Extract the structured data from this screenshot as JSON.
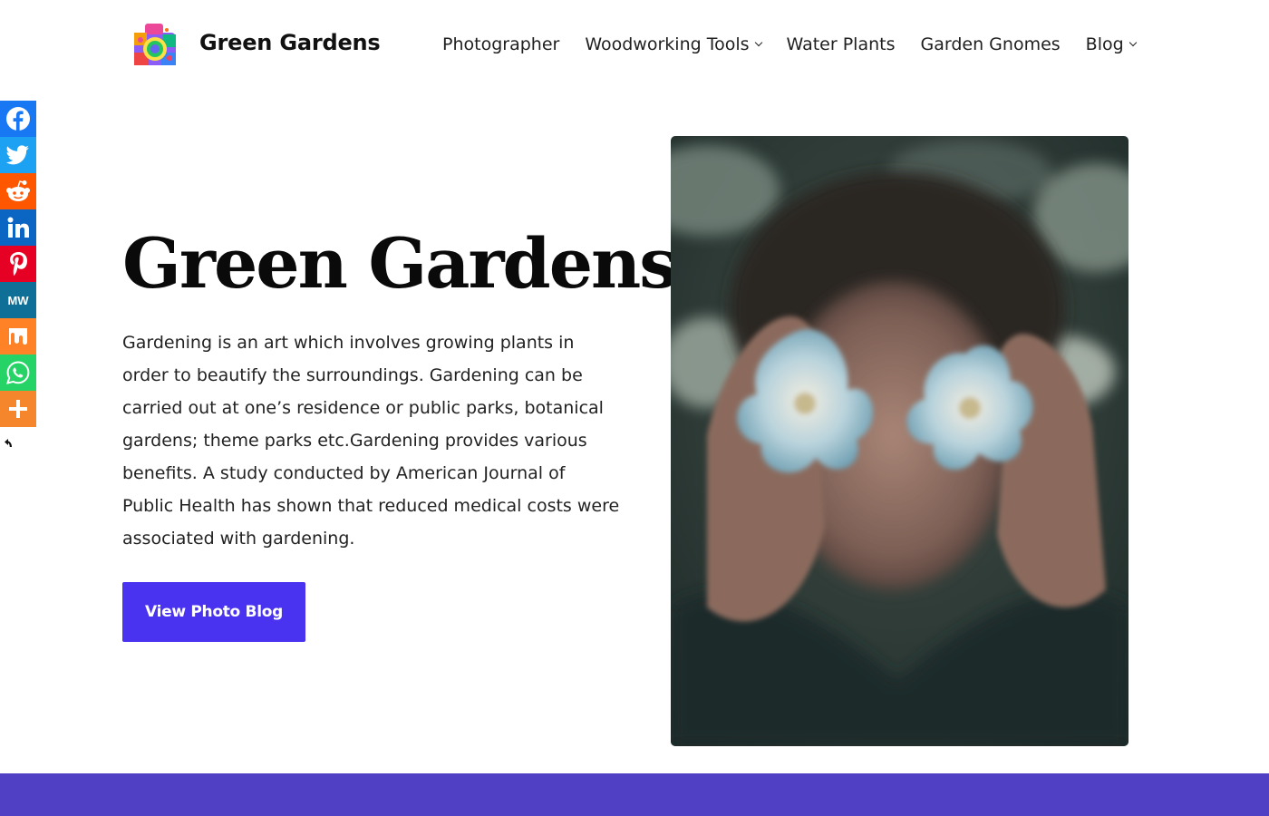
{
  "header": {
    "site_title": "Green Gardens",
    "logo_icon": "camera-flowers-logo-icon"
  },
  "nav": {
    "items": [
      {
        "label": "Photographer",
        "has_dropdown": false
      },
      {
        "label": "Woodworking Tools",
        "has_dropdown": true
      },
      {
        "label": "Water Plants",
        "has_dropdown": false
      },
      {
        "label": "Garden Gnomes",
        "has_dropdown": false
      },
      {
        "label": "Blog",
        "has_dropdown": true
      }
    ]
  },
  "social": {
    "buttons": [
      {
        "name": "facebook",
        "icon": "facebook-icon",
        "color": "#1877f2"
      },
      {
        "name": "twitter",
        "icon": "twitter-icon",
        "color": "#1da1f2"
      },
      {
        "name": "reddit",
        "icon": "reddit-icon",
        "color": "#ff5700"
      },
      {
        "name": "linkedin",
        "icon": "linkedin-icon",
        "color": "#0a66c2"
      },
      {
        "name": "pinterest",
        "icon": "pinterest-icon",
        "color": "#e60023"
      },
      {
        "name": "mewe",
        "icon": "mewe-icon",
        "color": "#0f6f97"
      },
      {
        "name": "mix",
        "icon": "mix-icon",
        "color": "#ff8226"
      },
      {
        "name": "whatsapp",
        "icon": "whatsapp-icon",
        "color": "#25d366"
      },
      {
        "name": "more",
        "icon": "plus-icon",
        "color": "#f6862b"
      }
    ],
    "collapse_icon": "hide-arrow-icon"
  },
  "hero": {
    "title": "Green Gardens",
    "body": "Gardening is an art which involves growing plants in order to beautify the surroundings. Gardening can be carried out at one’s residence or public parks, botanical gardens; theme parks etc.Gardening provides various benefits. A study conducted by American Journal of Public Health has shown that reduced medical costs were associated with gardening.",
    "cta_label": "View Photo Blog",
    "cta_color": "#4a33f0",
    "image": "photo of a person holding two pale blue flowers over their eyes"
  },
  "footer_band": {
    "color": "#4f40c4"
  }
}
